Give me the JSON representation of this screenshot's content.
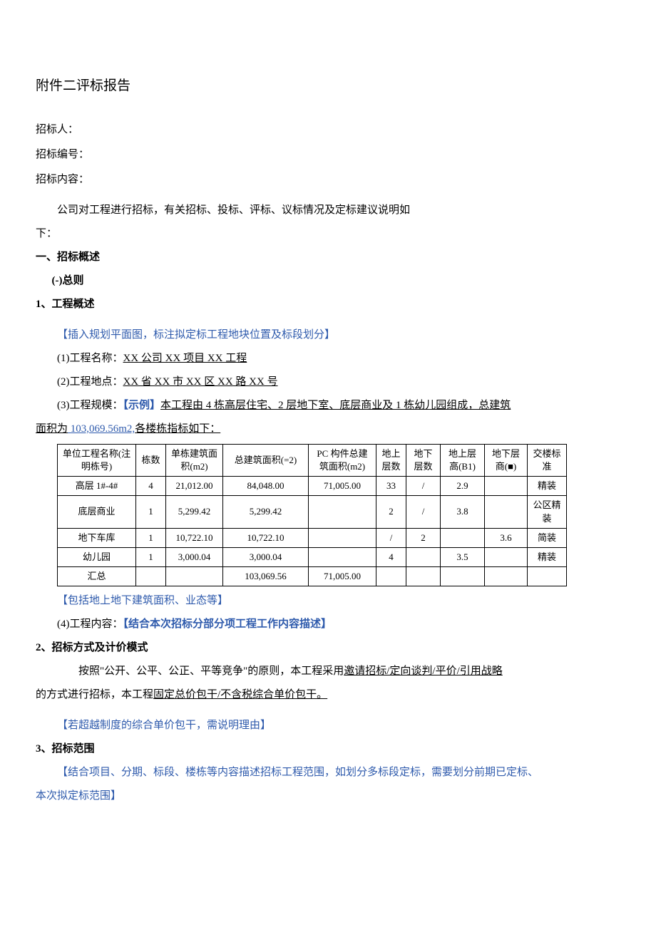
{
  "title": "附件二评标报告",
  "fields": {
    "tenderer_label": "招标人：",
    "tender_no_label": "招标编号：",
    "tender_content_label": "招标内容："
  },
  "intro": "公司对工程进行招标，有关招标、投标、评标、议标情况及定标建议说明如",
  "intro_continue": "下：",
  "s1": {
    "head": "一、招标概述",
    "sub": "(-)总则",
    "item1": "1、工程概述",
    "plan_note": "【插入规划平面图，标注拟定标工程地块位置及标段划分】",
    "p1_label": "(1)工程名称：",
    "p1_value": "XX 公司 XX 项目 XX 工程",
    "p2_label": "(2)工程地点：",
    "p2_value": "XX 省 XX 市 XX 区 XX 路 XX 号",
    "p3_label": "(3)工程规模：",
    "p3_example_label": "【示例】",
    "p3_value": "本工程由 4 栋高层住宅、2 层地下室、底层商业及 1 栋幼儿园组成，总建筑",
    "p3_line2a": "面积为",
    "p3_area": " 103,069.56m2,",
    "p3_line2b": "各楼栋指标如下：",
    "table_note": "【包括地上地下建筑面积、业态等】",
    "p4_label": "(4)工程内容：",
    "p4_value": "【结合本次招标分部分项工程工作内容描述】",
    "item2": "2、招标方式及计价模式",
    "mode_para1": "按照\"公开、公平、公正、平等竞争\"的原则，本工程采用",
    "mode_link1": "邀请招标/定向谈判/平价/引用战略",
    "mode_para2a": "的方式进行招标，本工程",
    "mode_link2": "固定总价包干/不含税综合单价包干。",
    "mode_note": "【若超越制度的综合单价包干，需说明理由】",
    "item3": "3、招标范围",
    "range_note1": "【结合项目、分期、标段、楼栋等内容描述招标工程范围，如划分多标段定标，需要划分前期已定标、",
    "range_note2": "本次拟定标范围】"
  },
  "table": {
    "headers": {
      "c1": "单位工程名称(注明栋号)",
      "c2": "栋数",
      "c3": "单栋建筑面积(m2)",
      "c4": "总建筑面积(=2)",
      "c5": "PC 构件总建筑面积(m2)",
      "c6": "地上层数",
      "c7": "地下层数",
      "c8": "地上层高(B1)",
      "c9": "地下层商(■)",
      "c10": "交楼标准"
    },
    "rows": [
      {
        "c1": "高层 1#-4#",
        "c2": "4",
        "c3": "21,012.00",
        "c4": "84,048.00",
        "c5": "71,005.00",
        "c6": "33",
        "c7": "/",
        "c8": "2.9",
        "c9": "",
        "c10": "精装"
      },
      {
        "c1": "底层商业",
        "c2": "1",
        "c3": "5,299.42",
        "c4": "5,299.42",
        "c5": "",
        "c6": "2",
        "c7": "/",
        "c8": "3.8",
        "c9": "",
        "c10": "公区精装"
      },
      {
        "c1": "地下车库",
        "c2": "1",
        "c3": "10,722.10",
        "c4": "10,722.10",
        "c5": "",
        "c6": "/",
        "c7": "2",
        "c8": "",
        "c9": "3.6",
        "c10": "简装"
      },
      {
        "c1": "幼儿园",
        "c2": "1",
        "c3": "3,000.04",
        "c4": "3,000.04",
        "c5": "",
        "c6": "4",
        "c7": "",
        "c8": "3.5",
        "c9": "",
        "c10": "精装"
      },
      {
        "c1": "汇总",
        "c2": "",
        "c3": "",
        "c4": "103,069.56",
        "c5": "71,005.00",
        "c6": "",
        "c7": "",
        "c8": "",
        "c9": "",
        "c10": ""
      }
    ]
  }
}
